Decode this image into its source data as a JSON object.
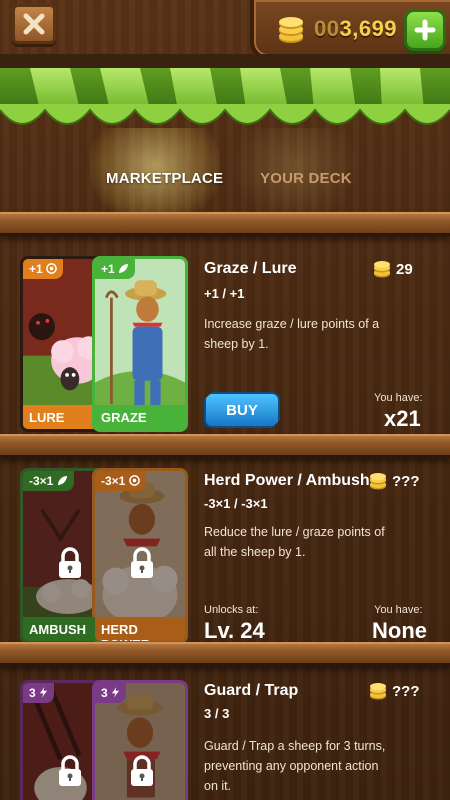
{
  "header": {
    "coins_leading": "00",
    "coins_value": "3,699"
  },
  "tabs": [
    {
      "label": "MARKETPLACE",
      "active": true
    },
    {
      "label": "YOUR DECK",
      "active": false
    }
  ],
  "items": [
    {
      "title": "Graze / Lure",
      "effect": "+1 / +1",
      "description": "Increase graze / lure points of a sheep by 1.",
      "price": "29",
      "button_label": "BUY",
      "owned_label": "You have:",
      "owned_value": "x21",
      "cards": [
        {
          "tag": "+1",
          "label": "LURE",
          "type": "lure",
          "icon": "lure-icon"
        },
        {
          "tag": "+1",
          "label": "GRAZE",
          "type": "graze",
          "icon": "graze-icon"
        }
      ]
    },
    {
      "title": "Herd Power / Ambush",
      "effect": "-3×1 / -3×1",
      "description": "Reduce the lure / graze points of all the sheep by 1.",
      "price": "???",
      "unlock_label": "Unlocks at:",
      "unlock_value": "Lv. 24",
      "owned_label": "You have:",
      "owned_value": "None",
      "cards": [
        {
          "tag": "-3×1",
          "label": "AMBUSH",
          "type": "graze",
          "icon": "graze-icon"
        },
        {
          "tag": "-3×1",
          "label": "HERD POWER",
          "type": "lure",
          "icon": "lure-icon"
        }
      ]
    },
    {
      "title": "Guard / Trap",
      "effect": "3 / 3",
      "description": "Guard / Trap a sheep for 3 turns, preventing any opponent action on it.",
      "price": "???",
      "cards": [
        {
          "tag": "3",
          "label": "",
          "type": "guard",
          "icon": "lightning-icon"
        },
        {
          "tag": "3",
          "label": "",
          "type": "trap",
          "icon": "lightning-icon"
        }
      ]
    }
  ],
  "colors": {
    "wood": "#5a3216",
    "coin": "#f6d04d",
    "buy_button": "#2a9be8",
    "plus_button": "#5cc22a",
    "awning_green": "#7cc63a"
  }
}
